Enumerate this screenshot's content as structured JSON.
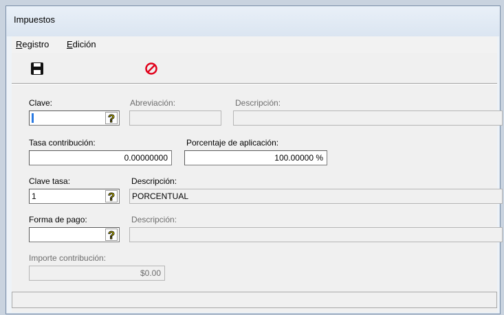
{
  "window": {
    "title": "Impuestos"
  },
  "menu": [
    {
      "accel": "R",
      "rest": "egistro"
    },
    {
      "accel": "E",
      "rest": "dición"
    }
  ],
  "toolbar": {
    "save_icon": "floppy-disk-icon",
    "cancel_icon": "cancel-circle-icon",
    "cancel_color": "#e1001a"
  },
  "form": {
    "clave_label": "Clave:",
    "clave_value": "",
    "abreviacion_label": "Abreviación:",
    "abreviacion_value": "",
    "descripcion1_label": "Descripción:",
    "descripcion1_value": "",
    "tasa_contribucion_label": "Tasa contribución:",
    "tasa_contribucion_value": "0.00000000",
    "porcentaje_label": "Porcentaje de aplicación:",
    "porcentaje_value": "100.00000 %",
    "clave_tasa_label": "Clave tasa:",
    "clave_tasa_value": "1",
    "descripcion2_label": "Descripción:",
    "descripcion2_value": "PORCENTUAL",
    "forma_pago_label": "Forma de pago:",
    "forma_pago_value": "",
    "descripcion3_label": "Descripción:",
    "descripcion3_value": "",
    "importe_label": "Importe contribución:",
    "importe_value": "$0.00",
    "lookup_symbol": "?"
  },
  "statusbar": {
    "text": ""
  }
}
